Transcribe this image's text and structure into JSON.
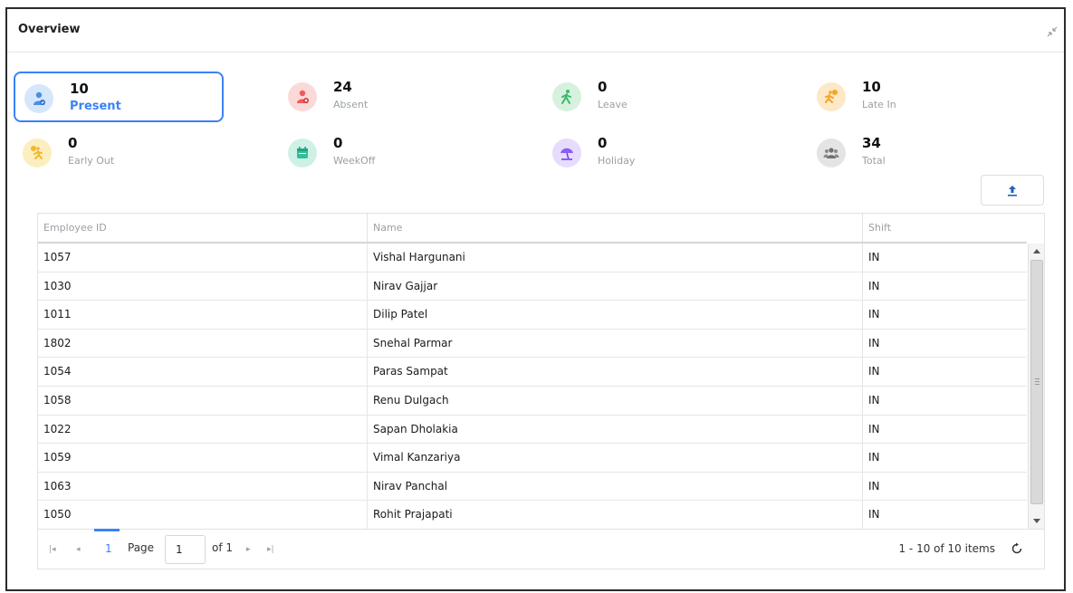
{
  "panel": {
    "title": "Overview"
  },
  "summary": [
    {
      "id": "present",
      "value": "10",
      "label": "Present",
      "icon": "user-check-icon",
      "color": "#4a90e2",
      "bg": "#d6e6fb"
    },
    {
      "id": "absent",
      "value": "24",
      "label": "Absent",
      "icon": "user-x-icon",
      "color": "#ef5b5b",
      "bg": "#fcd9d9"
    },
    {
      "id": "leave",
      "value": "0",
      "label": "Leave",
      "icon": "walking-person-icon",
      "color": "#3fb86a",
      "bg": "#d6f2df"
    },
    {
      "id": "late-in",
      "value": "10",
      "label": "Late In",
      "icon": "running-person-icon",
      "color": "#f5a524",
      "bg": "#fde8c7"
    },
    {
      "id": "early-out",
      "value": "0",
      "label": "Early Out",
      "icon": "running-out-icon",
      "color": "#f2b92b",
      "bg": "#fdeec0"
    },
    {
      "id": "weekoff",
      "value": "0",
      "label": "WeekOff",
      "icon": "calendar-icon",
      "color": "#2fbf9a",
      "bg": "#cff1e5"
    },
    {
      "id": "holiday",
      "value": "0",
      "label": "Holiday",
      "icon": "beach-umbrella-icon",
      "color": "#8b5cf6",
      "bg": "#e6dcfd"
    },
    {
      "id": "total",
      "value": "34",
      "label": "Total",
      "icon": "group-icon",
      "color": "#7a7a7a",
      "bg": "#e4e4e4"
    }
  ],
  "grid": {
    "columns": [
      "Employee ID",
      "Name",
      "Shift"
    ],
    "rows": [
      [
        "1057",
        "Vishal Hargunani",
        "IN"
      ],
      [
        "1030",
        "Nirav Gajjar",
        "IN"
      ],
      [
        "1011",
        "Dilip Patel",
        "IN"
      ],
      [
        "1802",
        "Snehal Parmar",
        "IN"
      ],
      [
        "1054",
        "Paras Sampat",
        "IN"
      ],
      [
        "1058",
        "Renu Dulgach",
        "IN"
      ],
      [
        "1022",
        "Sapan Dholakia",
        "IN"
      ],
      [
        "1059",
        "Vimal Kanzariya",
        "IN"
      ],
      [
        "1063",
        "Nirav Panchal",
        "IN"
      ],
      [
        "1050",
        "Rohit Prajapati",
        "IN"
      ]
    ]
  },
  "pager": {
    "current_page": "1",
    "page_label": "Page",
    "page_input": "1",
    "of_label": "of 1",
    "summary": "1 - 10 of 10 items"
  }
}
